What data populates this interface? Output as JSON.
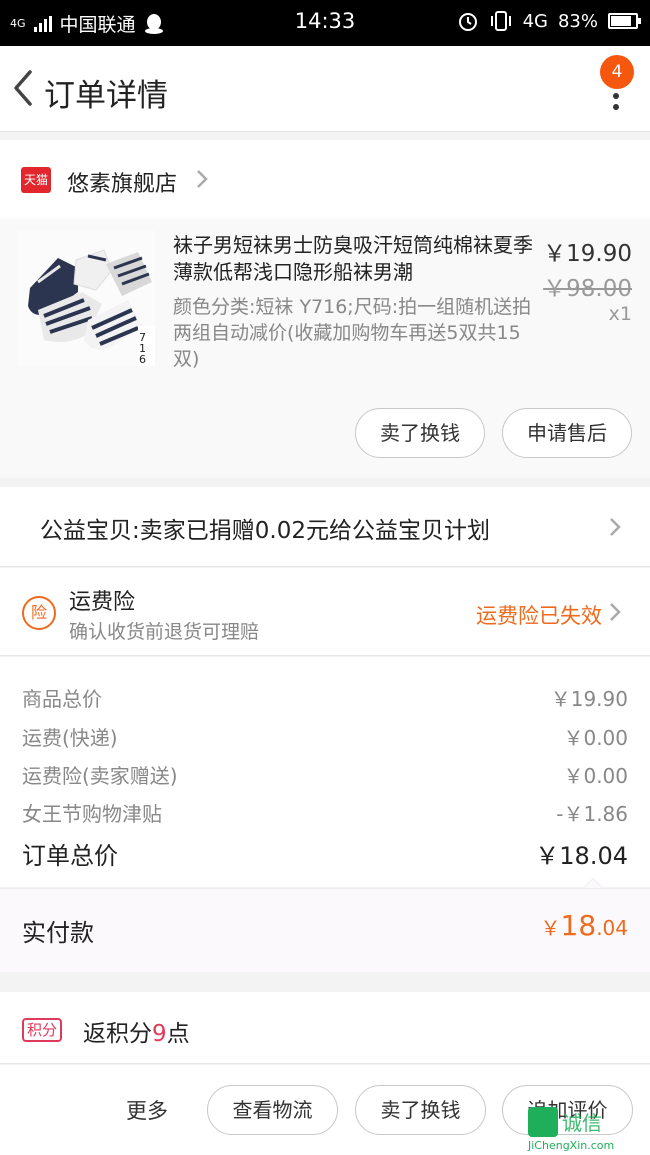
{
  "status_bar": {
    "signal": "4G",
    "carrier": "中国联通",
    "time": "14:33",
    "network": "4G",
    "battery": "83%",
    "battery_level": 0.83
  },
  "header": {
    "title": "订单详情",
    "badge_count": "4"
  },
  "shop": {
    "badge": "天猫",
    "name": "悠素旗舰店"
  },
  "product": {
    "title": "袜子男短袜男士防臭吸汗短筒纯棉袜夏季薄款低帮浅口隐形船袜男潮",
    "spec": "颜色分类:短袜 Y716;尺码:拍一组随机送拍两组自动减价(收藏加购物车再送5双共15双)",
    "thumb_label": "716",
    "price": "￥19.90",
    "original_price": "￥98.00",
    "quantity": "x1",
    "sell_button": "卖了换钱",
    "after_sale_button": "申请售后"
  },
  "charity": {
    "text": "公益宝贝:卖家已捐赠0.02元给公益宝贝计划"
  },
  "insurance": {
    "icon_text": "险",
    "title": "运费险",
    "subtitle": "确认收货前退货可理赔",
    "status": "运费险已失效"
  },
  "price_lines": [
    {
      "label": "商品总价",
      "value": "￥19.90"
    },
    {
      "label": "运费(快递)",
      "value": "￥0.00"
    },
    {
      "label": "运费险(卖家赠送)",
      "value": "￥0.00"
    },
    {
      "label": "女王节购物津贴",
      "value": "-￥1.86"
    }
  ],
  "order_total": {
    "label": "订单总价",
    "value": "￥18.04"
  },
  "paid": {
    "label": "实付款",
    "currency": "￥",
    "integer": "18",
    "decimal": ".04"
  },
  "points": {
    "icon_text": "积分",
    "prefix": "返积分",
    "count": "9",
    "suffix": "点"
  },
  "bottom_bar": {
    "more": "更多",
    "logistics_button": "查看物流",
    "sell_button": "卖了换钱",
    "review_button": "追加评价"
  },
  "watermark": {
    "text": "诚信",
    "url": "JiChengXin.com"
  },
  "colors": {
    "accent": "#ee6a1c",
    "badge": "#f5570f",
    "tmall": "#e1272d",
    "points": "#e03a5a"
  }
}
